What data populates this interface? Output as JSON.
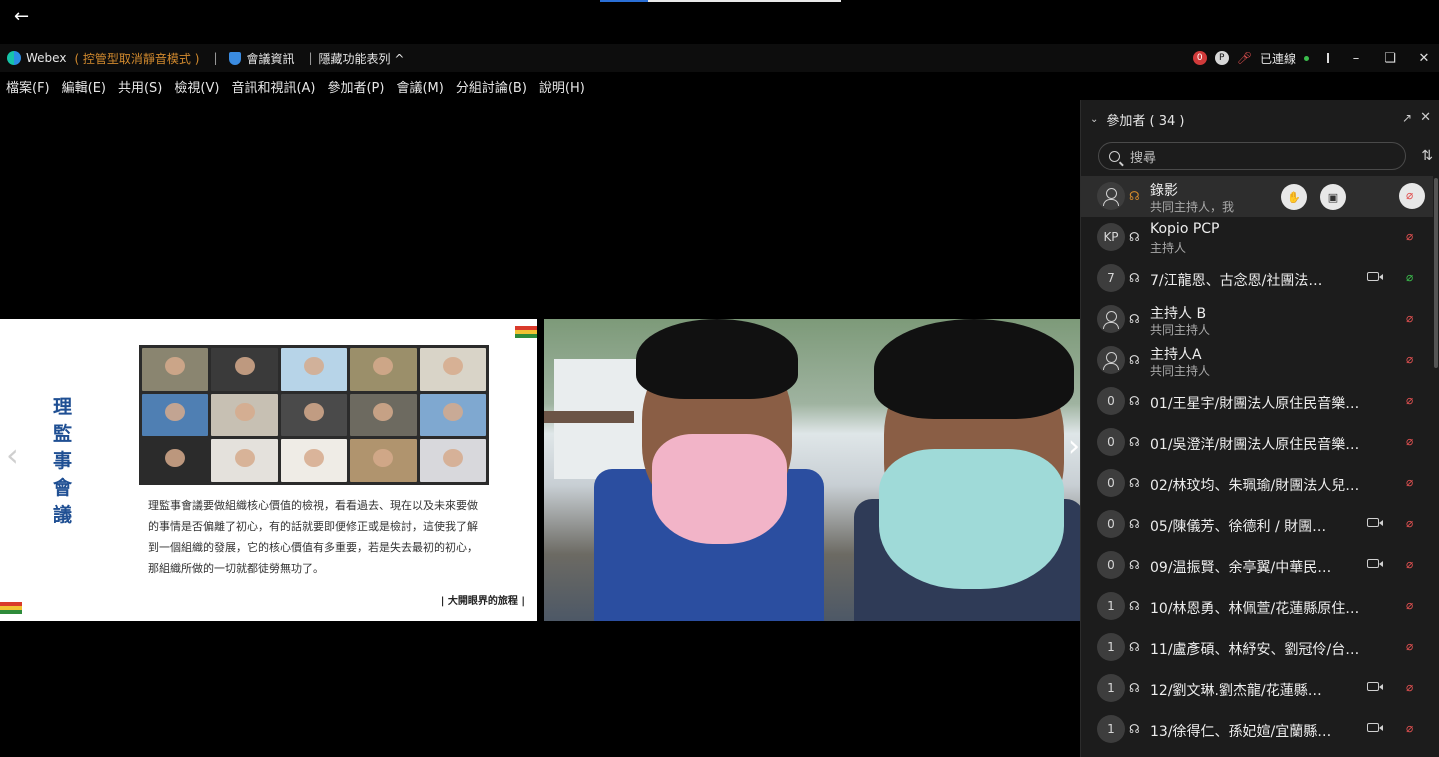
{
  "top": {
    "back_icon": "arrow-left-icon"
  },
  "titlebar": {
    "app_name": "Webex",
    "mode_text": "( 控管型取消靜音模式 )",
    "separator": "|",
    "meeting_info_label": "會議資訊",
    "hide_menu_label": "隱藏功能表列 ^",
    "badge_count": "0",
    "presenter_badge": "P",
    "connection_label": "已連線",
    "status_color": "#3bbd4c"
  },
  "menubar": {
    "items": [
      "檔案(F)",
      "編輯(E)",
      "共用(S)",
      "檢視(V)",
      "音訊和視訊(A)",
      "參加者(P)",
      "會議(M)",
      "分組討論(B)",
      "說明(H)"
    ]
  },
  "slide": {
    "title": "理監事會議",
    "body": "理監事會議要做組織核心價值的檢視，看看過去、現在以及未來要做的事情是否偏離了初心，有的話就要即便修正或是檢討，這使我了解到一個組織的發展，它的核心價值有多重要，若是失去最初的初心，那組織所做的一切就都徒勞無功了。",
    "footer": "| 大開眼界的旅程 |"
  },
  "panel": {
    "header_title": "參加者 ( 34 )",
    "search_placeholder": "搜尋",
    "participants": [
      {
        "avatar": "",
        "name": "錄影",
        "role": "共同主持人，我",
        "video": false,
        "mic": "muted"
      },
      {
        "avatar": "KP",
        "name": "Kopio PCP",
        "role": "主持人",
        "video": false,
        "mic": "muted"
      },
      {
        "avatar": "7",
        "name": "7/江龍恩、古念恩/社團法…",
        "role": "",
        "video": true,
        "mic": "active"
      },
      {
        "avatar": "",
        "name": "主持人 B",
        "role": "共同主持人",
        "video": false,
        "mic": "muted"
      },
      {
        "avatar": "",
        "name": "主持人A",
        "role": "共同主持人",
        "video": false,
        "mic": "muted"
      },
      {
        "avatar": "0",
        "name": "01/王星宇/財團法人原住民音樂…",
        "role": "",
        "video": false,
        "mic": "muted"
      },
      {
        "avatar": "0",
        "name": "01/吳澄洋/財團法人原住民音樂…",
        "role": "",
        "video": false,
        "mic": "muted"
      },
      {
        "avatar": "0",
        "name": "02/林玟均、朱珮瑜/財團法人兒…",
        "role": "",
        "video": false,
        "mic": "muted"
      },
      {
        "avatar": "0",
        "name": "05/陳儀芳、徐德利 / 財團…",
        "role": "",
        "video": true,
        "mic": "muted"
      },
      {
        "avatar": "0",
        "name": "09/温振賢、余亭翼/中華民…",
        "role": "",
        "video": true,
        "mic": "muted"
      },
      {
        "avatar": "1",
        "name": "10/林恩勇、林佩萱/花蓮縣原住…",
        "role": "",
        "video": false,
        "mic": "muted"
      },
      {
        "avatar": "1",
        "name": "11/盧彥碩、林紓安、劉冠伶/台…",
        "role": "",
        "video": false,
        "mic": "muted"
      },
      {
        "avatar": "1",
        "name": "12/劉文琳.劉杰龍/花蓮縣…",
        "role": "",
        "video": true,
        "mic": "muted"
      },
      {
        "avatar": "1",
        "name": "13/徐得仁、孫妃媗/宜蘭縣…",
        "role": "",
        "video": true,
        "mic": "muted"
      }
    ]
  }
}
